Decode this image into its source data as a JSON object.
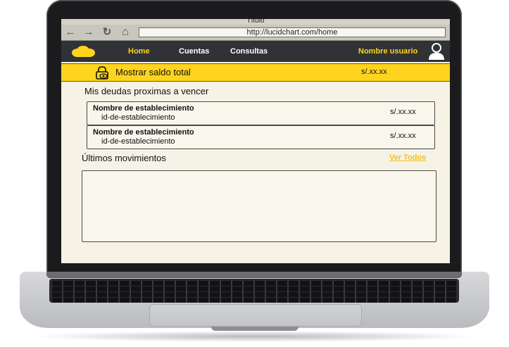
{
  "browser": {
    "title": "Título",
    "url": "http://lucidchart.com/home",
    "back_icon": "←",
    "forward_icon": "→",
    "reload_icon": "↻",
    "home_icon": "⌂"
  },
  "navbar": {
    "links": [
      "Home",
      "Cuentas",
      "Consultas"
    ],
    "active": "Home",
    "user_name": "Nombre usuario",
    "accent": "#ffd41e",
    "background": "#303236"
  },
  "balance": {
    "label": "Mostrar saldo total",
    "amount": "s/.xx.xx",
    "background": "#ffd41e"
  },
  "debts": {
    "title": "Mis deudas proximas a vencer",
    "items": [
      {
        "name": "Nombre de establecimiento",
        "id": "id-de-establecimiento",
        "amount": "s/.xx.xx"
      },
      {
        "name": "Nombre de establecimiento",
        "id": "id-de-establecimiento",
        "amount": "s/.xx.xx"
      }
    ]
  },
  "movements": {
    "title": "Últimos movimientos",
    "see_all": "Ver Todos"
  },
  "icons": [
    "laptop-device",
    "cloud-logo-icon",
    "user-avatar-icon",
    "lock-eye-icon"
  ]
}
